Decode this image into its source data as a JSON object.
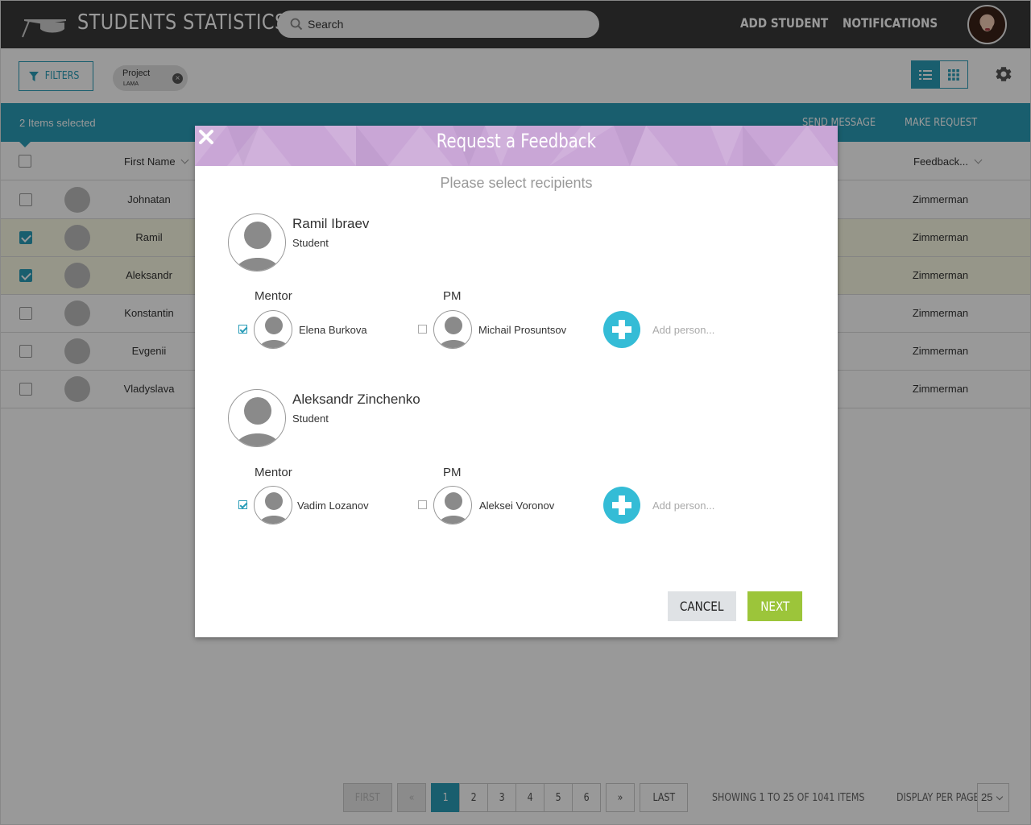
{
  "header": {
    "app_title": "STUDENTS STATISTICS",
    "search_placeholder": "Search",
    "nav": {
      "add_student": "ADD STUDENT",
      "notifications": "NOTIFICATIONS"
    }
  },
  "filters": {
    "button_label": "FILTERS",
    "chip": {
      "label": "Project",
      "value": "LAMA"
    }
  },
  "selection_bar": {
    "count_text": "2 Items selected",
    "actions": {
      "send_message": "SEND MESSAGE",
      "make_request": "MAKE REQUEST"
    }
  },
  "table": {
    "columns": {
      "first_name": "First Name",
      "feedback": "Feedback..."
    },
    "rows": [
      {
        "first_name": "Johnatan",
        "feedback": "Zimmerman",
        "selected": false
      },
      {
        "first_name": "Ramil",
        "feedback": "Zimmerman",
        "selected": true
      },
      {
        "first_name": "Aleksandr",
        "feedback": "Zimmerman",
        "selected": true
      },
      {
        "first_name": "Konstantin",
        "feedback": "Zimmerman",
        "selected": false
      },
      {
        "first_name": "Evgenii",
        "feedback": "Zimmerman",
        "selected": false
      },
      {
        "first_name": "Vladyslava",
        "feedback": "Zimmerman",
        "selected": false
      }
    ]
  },
  "pagination": {
    "first": "FIRST",
    "prev": "«",
    "pages": [
      "1",
      "2",
      "3",
      "4",
      "5",
      "6"
    ],
    "current_page": "1",
    "next": "»",
    "last": "LAST",
    "info": "SHOWING 1 TO 25 OF 1041 ITEMS",
    "per_page_label": "DISPLAY PER PAGE",
    "per_page_value": "25"
  },
  "modal": {
    "title": "Request a Feedback",
    "subtitle": "Please select recipients",
    "students": [
      {
        "name": "Ramil Ibraev",
        "role": "Student",
        "mentor_label": "Mentor",
        "pm_label": "PM",
        "mentor": {
          "name": "Elena Burkova",
          "checked": true
        },
        "pm": {
          "name": "Michail Prosuntsov",
          "checked": false
        },
        "add_person": "Add person..."
      },
      {
        "name": "Aleksandr Zinchenko",
        "role": "Student",
        "mentor_label": "Mentor",
        "pm_label": "PM",
        "mentor": {
          "name": "Vadim Lozanov",
          "checked": true
        },
        "pm": {
          "name": "Aleksei Voronov",
          "checked": false
        },
        "add_person": "Add person..."
      }
    ],
    "cancel_label": "CANCEL",
    "next_label": "NEXT"
  },
  "colors": {
    "topbar": "#3a3a3a",
    "accent": "#2a9db8",
    "modal_header": "#c9a6d6",
    "add_button": "#34bcd6",
    "next_button": "#9cc53a",
    "cancel_button": "#dfe2e5",
    "selected_row": "#fbfbe4"
  },
  "icons": {
    "logo": "graduation-cap-icon",
    "search": "search-icon",
    "filter": "funnel-icon",
    "chip_close": "close-circle-icon",
    "list_view": "list-icon",
    "grid_view": "grid-icon",
    "settings": "gear-icon",
    "modal_close": "close-icon",
    "add": "plus-icon",
    "person": "person-icon"
  }
}
